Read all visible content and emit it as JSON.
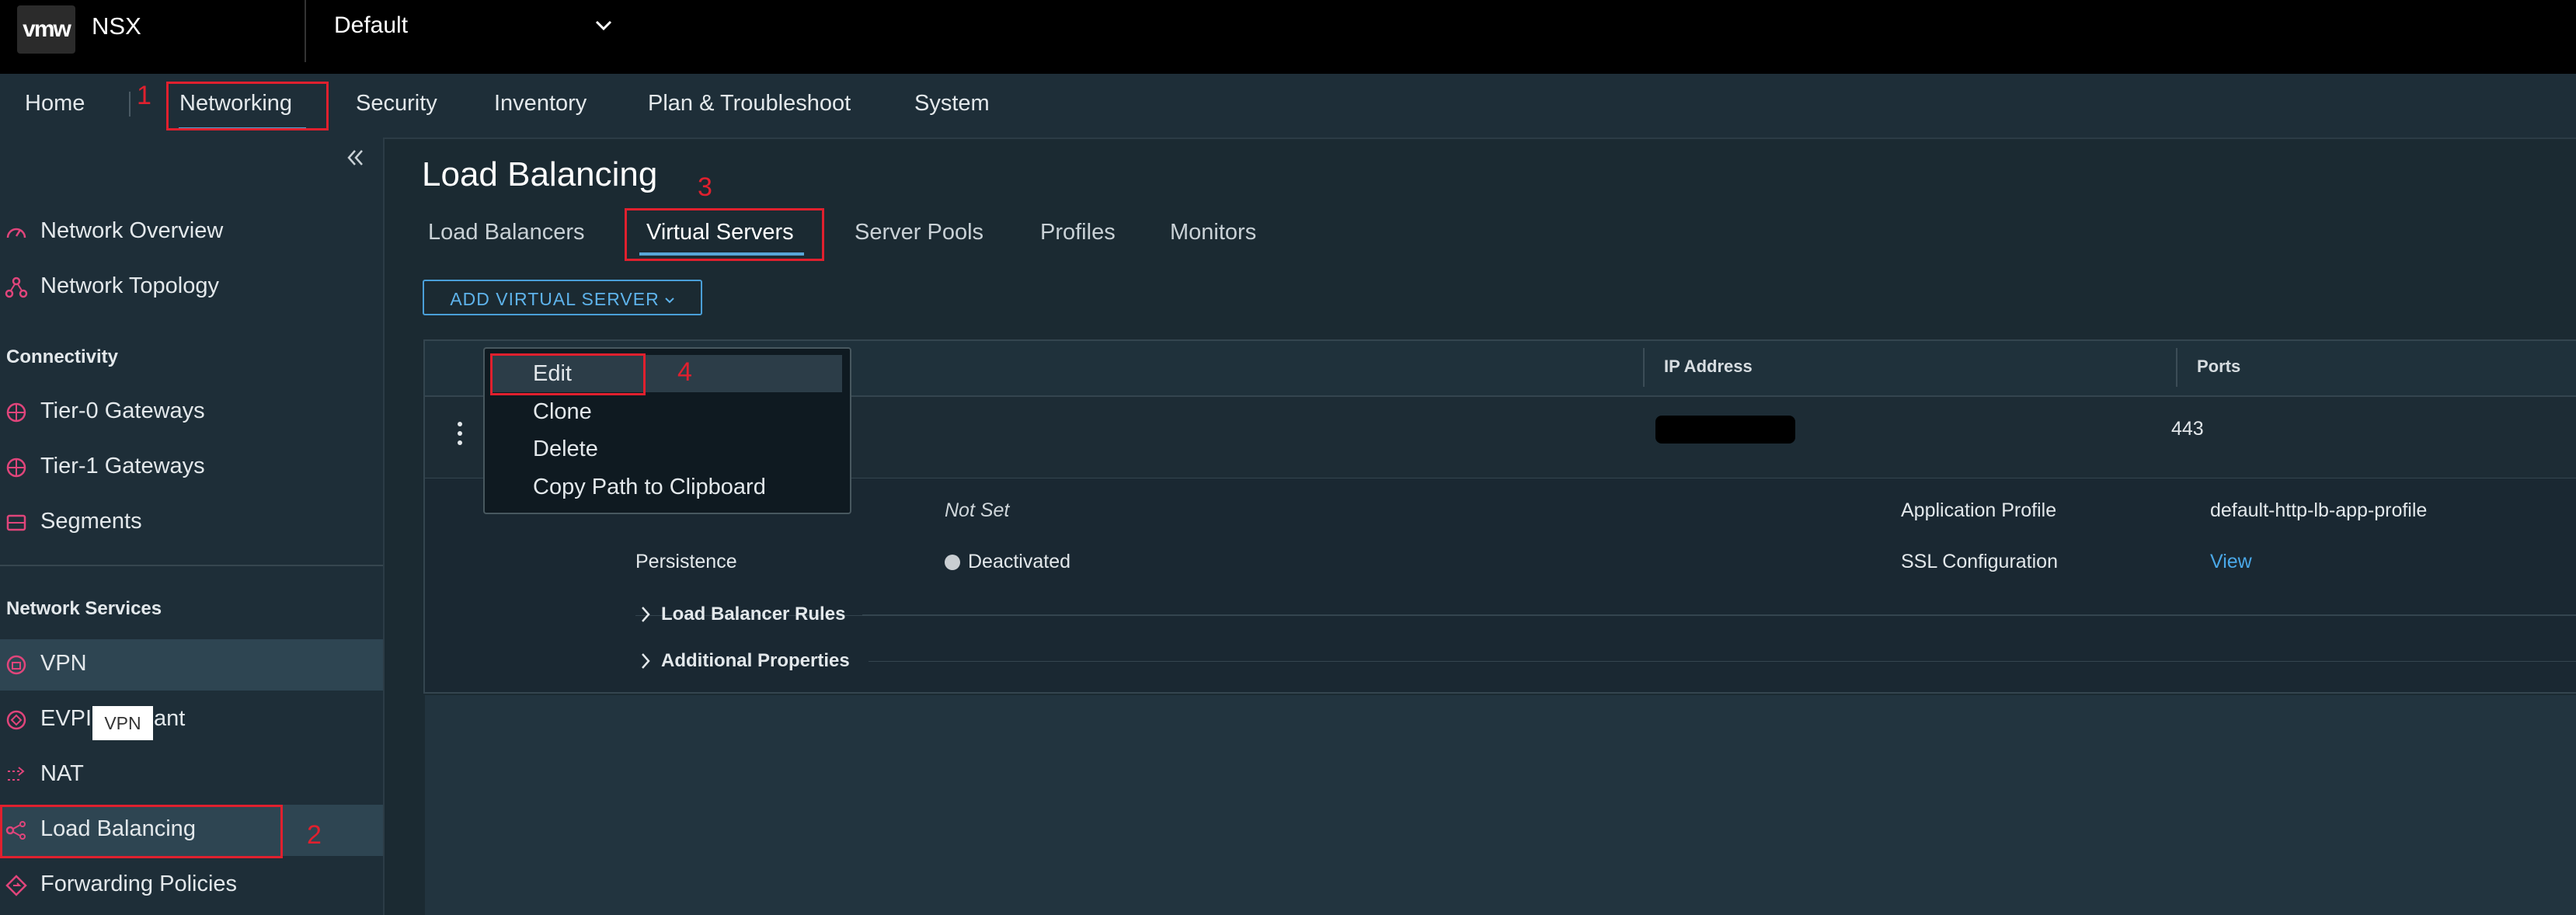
{
  "header": {
    "logo": "vmw",
    "app_name": "NSX",
    "context": "Default"
  },
  "nav": {
    "items": [
      "Home",
      "Networking",
      "Security",
      "Inventory",
      "Plan & Troubleshoot",
      "System"
    ]
  },
  "sidebar": {
    "items_top": [
      "Network Overview",
      "Network Topology"
    ],
    "connectivity_header": "Connectivity",
    "connectivity": [
      "Tier-0 Gateways",
      "Tier-1 Gateways",
      "Segments"
    ],
    "services_header": "Network Services",
    "services": [
      "VPN",
      "EVPN Tenant",
      "NAT",
      "Load Balancing",
      "Forwarding Policies"
    ],
    "evpn_visible_left": "EVPI",
    "evpn_visible_right": "ant",
    "tooltip": "VPN"
  },
  "main": {
    "title": "Load Balancing",
    "tabs": [
      "Load Balancers",
      "Virtual Servers",
      "Server Pools",
      "Profiles",
      "Monitors"
    ],
    "add_button": "ADD VIRTUAL SERVER",
    "columns": [
      "IP Address",
      "Ports"
    ],
    "row": {
      "port": "443"
    },
    "details": {
      "not_set": "Not Set",
      "persistence_label": "Persistence",
      "persistence_value": "Deactivated",
      "app_profile_label": "Application Profile",
      "app_profile_value": "default-http-lb-app-profile",
      "ssl_label": "SSL Configuration",
      "ssl_value": "View",
      "lb_rules": "Load Balancer Rules",
      "additional": "Additional Properties"
    }
  },
  "context_menu": {
    "items": [
      "Edit",
      "Clone",
      "Delete",
      "Copy Path to Clipboard"
    ]
  },
  "annotations": [
    "1",
    "2",
    "3",
    "4"
  ],
  "colors": {
    "accent": "#58a6d8",
    "annotation_red": "#e0202e",
    "sidebar_icon": "#e0457b"
  }
}
